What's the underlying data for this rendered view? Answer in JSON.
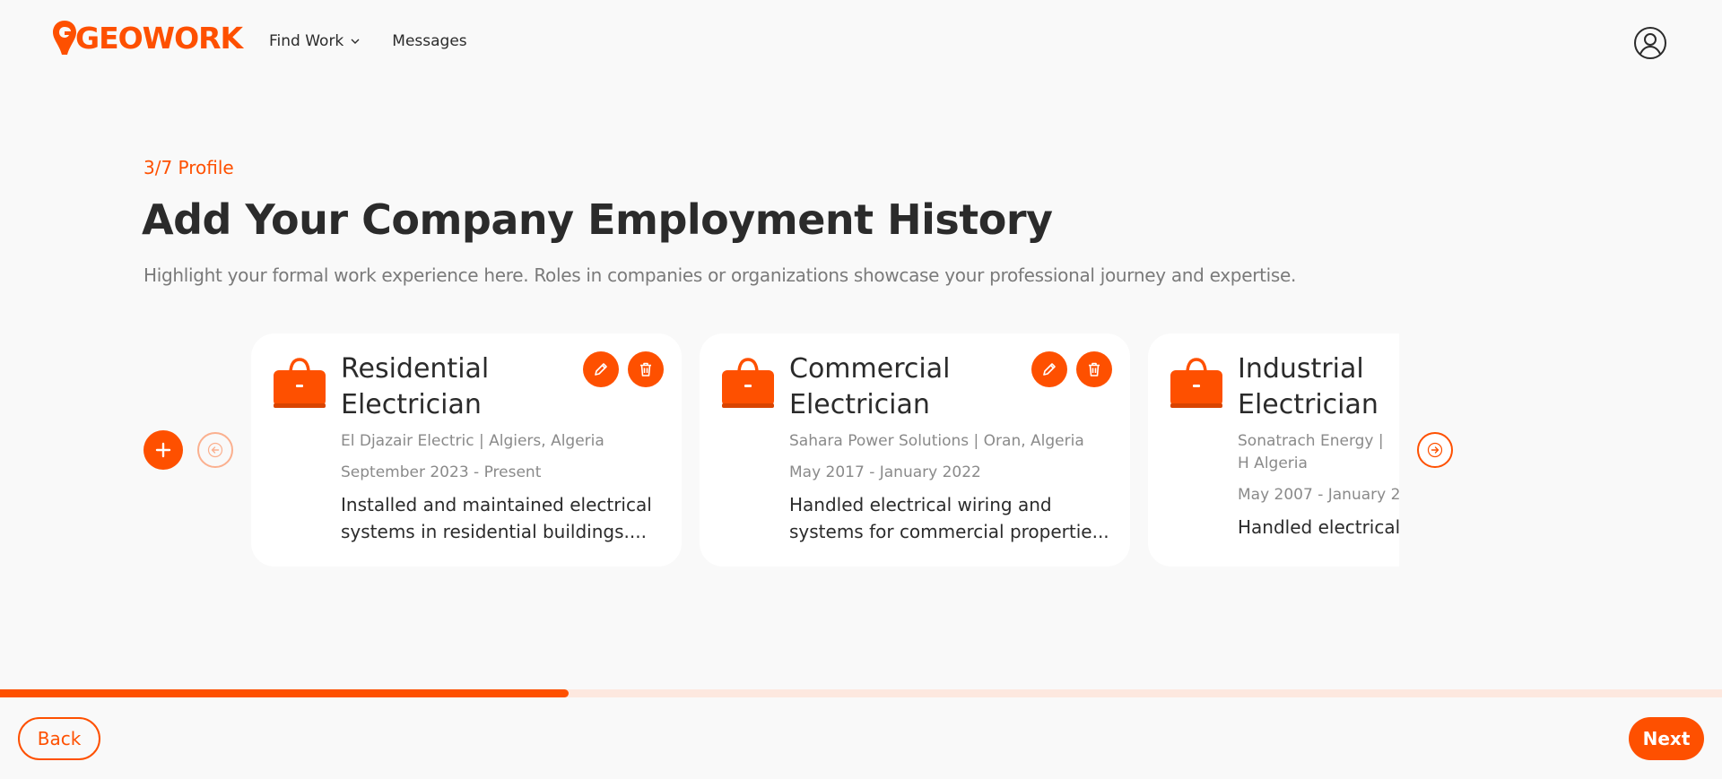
{
  "colors": {
    "accent": "#fe5000",
    "accent_light": "#fde8df",
    "background": "#f9f9f9",
    "text": "#2b2b2b",
    "muted": "#8a8a8a"
  },
  "header": {
    "logo_text": "GEOWORK",
    "nav": [
      {
        "label": "Find Work",
        "icon": "chevron-down-icon"
      },
      {
        "label": "Messages"
      }
    ],
    "user_icon": "user-circle-icon"
  },
  "intro": {
    "step": "3/7 Profile",
    "title": "Add Your Company Employment History",
    "subtitle": "Highlight your formal work experience here. Roles in companies or organizations showcase your professional journey and expertise."
  },
  "controls": {
    "add_icon": "plus-icon",
    "prev_icon": "arrow-left-icon",
    "next_icon": "arrow-right-icon"
  },
  "cards": [
    {
      "title": "Residential Electrician",
      "meta": "El Djazair Electric | Algiers, Algeria",
      "dates": "September 2023 - Present",
      "description": "Installed and maintained electrical systems in residential buildings...."
    },
    {
      "title": "Commercial Electrician",
      "meta": "Sahara Power Solutions | Oran, Algeria",
      "dates": "May 2017 - January 2022",
      "description": "Handled electrical wiring and systems for commercial propertie..."
    },
    {
      "title": "Industrial Electrician",
      "meta": "Sonatrach Energy | H Algeria",
      "dates": "May 2007 - January 2",
      "description": "Handled electrical"
    }
  ],
  "progress": {
    "percent": 33
  },
  "footer": {
    "back_label": "Back",
    "next_label": "Next"
  }
}
